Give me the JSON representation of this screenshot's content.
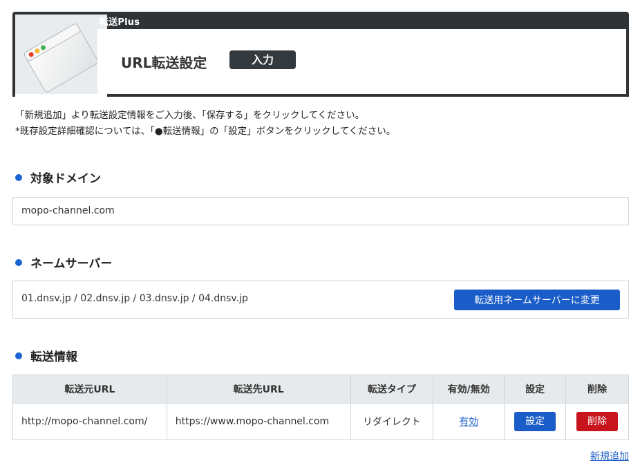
{
  "header": {
    "product": "転送Plus",
    "title": "URL転送設定",
    "mode": "入力"
  },
  "instructions": {
    "line1": "「新規追加」より転送設定情報をご入力後、「保存する」をクリックしてください。",
    "line2": "*既存設定詳細確認については、「●転送情報」の「設定」ボタンをクリックしてください。"
  },
  "domain_section": {
    "heading": "対象ドメイン",
    "value": "mopo-channel.com"
  },
  "nameserver_section": {
    "heading": "ネームサーバー",
    "value": "01.dnsv.jp / 02.dnsv.jp / 03.dnsv.jp / 04.dnsv.jp",
    "button": "転送用ネームサーバーに変更"
  },
  "forward_section": {
    "heading": "転送情報",
    "columns": [
      "転送元URL",
      "転送先URL",
      "転送タイプ",
      "有効/無効",
      "設定",
      "削除"
    ],
    "rows": [
      {
        "source": "http://mopo-channel.com/",
        "destination": "https://www.mopo-channel.com",
        "type": "リダイレクト",
        "status": "有効",
        "setting": "設定",
        "delete": "削除"
      }
    ],
    "add_link": "新規追加"
  },
  "colors": {
    "accent": "#1a5cc8",
    "danger": "#c8141c",
    "header_bg": "#2f3336"
  }
}
